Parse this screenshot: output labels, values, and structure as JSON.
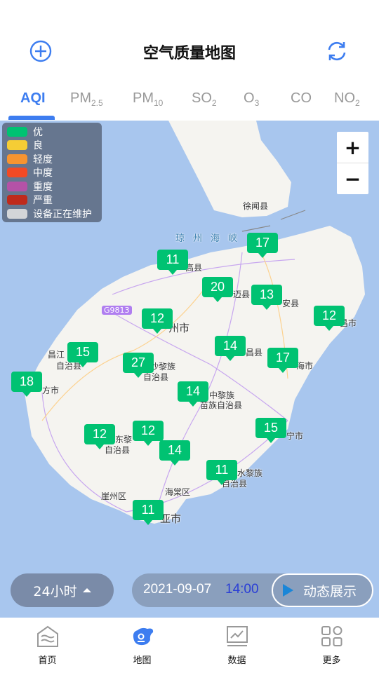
{
  "header": {
    "title": "空气质量地图",
    "add_icon": "plus-circle-icon",
    "refresh_icon": "refresh-icon"
  },
  "tabs": [
    {
      "main": "AQI",
      "sub": "",
      "active": true
    },
    {
      "main": "PM",
      "sub": "2.5"
    },
    {
      "main": "PM",
      "sub": "10"
    },
    {
      "main": "SO",
      "sub": "2"
    },
    {
      "main": "O",
      "sub": "3"
    },
    {
      "main": "CO",
      "sub": ""
    },
    {
      "main": "NO",
      "sub": "2"
    }
  ],
  "legend": [
    {
      "label": "优",
      "color": "#00c272"
    },
    {
      "label": "良",
      "color": "#f5cd35"
    },
    {
      "label": "轻度",
      "color": "#f79430"
    },
    {
      "label": "中度",
      "color": "#f24a25"
    },
    {
      "label": "重度",
      "color": "#b452a7"
    },
    {
      "label": "严重",
      "color": "#bf2a1c"
    },
    {
      "label": "设备正在维护",
      "color": "#d3d5d8"
    }
  ],
  "zoom": {
    "in": "+",
    "out": "−"
  },
  "place_labels": [
    "徐闻县",
    "琼州海峡",
    "高县",
    "迈县",
    "安县",
    "G9813",
    "州市",
    "昌市",
    "昌江",
    "自治县",
    "沙黎族",
    "自治县",
    "昌县",
    "海市",
    "方市",
    "中黎族",
    "苗族自治县",
    "东黎",
    "自治县",
    "宁市",
    "水黎族",
    "自治县",
    "海棠区",
    "崖州区",
    "亚市"
  ],
  "markers": [
    11,
    17,
    20,
    13,
    12,
    12,
    14,
    15,
    17,
    27,
    18,
    14,
    12,
    12,
    15,
    14,
    11,
    11
  ],
  "marker_color": "#00c272",
  "controls": {
    "range": "24小时",
    "date": "2021-09-07",
    "time": "14:00",
    "play_label": "动态展示"
  },
  "nav": [
    {
      "label": "首页",
      "icon": "home-icon"
    },
    {
      "label": "地图",
      "icon": "map-icon",
      "active": true
    },
    {
      "label": "数据",
      "icon": "chart-icon"
    },
    {
      "label": "更多",
      "icon": "grid-icon"
    }
  ]
}
